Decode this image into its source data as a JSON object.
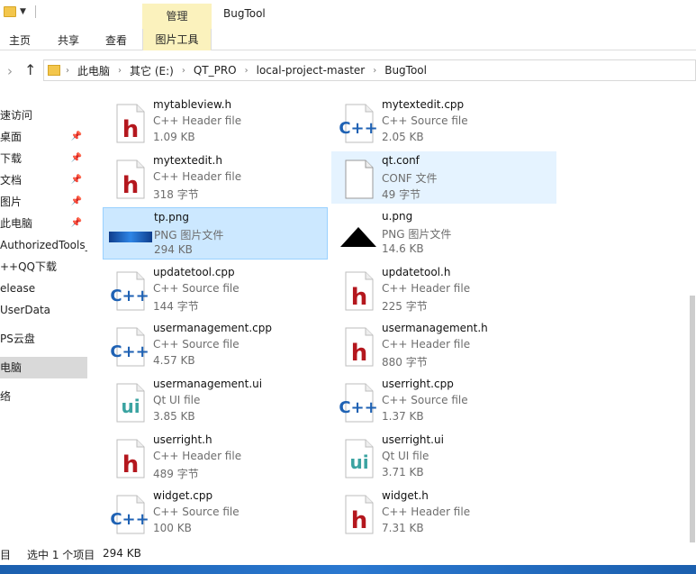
{
  "window": {
    "title": "BugTool",
    "contextual_group": "管理"
  },
  "ribbon": {
    "tabs": [
      "主页",
      "共享",
      "查看"
    ],
    "contextual_tab": "图片工具"
  },
  "address": {
    "crumbs": [
      "此电脑",
      "其它 (E:)",
      "QT_PRO",
      "local-project-master",
      "BugTool"
    ]
  },
  "sidebar": {
    "items": [
      "速访问",
      "桌面",
      "下载",
      "文档",
      "图片",
      "此电脑",
      "AuthorizedTools_I",
      "++QQ下载",
      "elease",
      "UserData",
      "PS云盘",
      "电脑",
      "络"
    ],
    "selected_index": 11
  },
  "files": [
    {
      "name": "mytableview.h",
      "type": "C++ Header file",
      "size": "1.09 KB",
      "icon": "h"
    },
    {
      "name": "mytextedit.cpp",
      "type": "C++ Source file",
      "size": "2.05 KB",
      "icon": "cpp"
    },
    {
      "name": "mytextedit.h",
      "type": "C++ Header file",
      "size": "318 字节",
      "icon": "h"
    },
    {
      "name": "qt.conf",
      "type": "CONF 文件",
      "size": "49 字节",
      "icon": "doc"
    },
    {
      "name": "tp.png",
      "type": "PNG 图片文件",
      "size": "294 KB",
      "icon": "png-blue"
    },
    {
      "name": "u.png",
      "type": "PNG 图片文件",
      "size": "14.6 KB",
      "icon": "png-tri"
    },
    {
      "name": "updatetool.cpp",
      "type": "C++ Source file",
      "size": "144 字节",
      "icon": "cpp"
    },
    {
      "name": "updatetool.h",
      "type": "C++ Header file",
      "size": "225 字节",
      "icon": "h"
    },
    {
      "name": "usermanagement.cpp",
      "type": "C++ Source file",
      "size": "4.57 KB",
      "icon": "cpp"
    },
    {
      "name": "usermanagement.h",
      "type": "C++ Header file",
      "size": "880 字节",
      "icon": "h"
    },
    {
      "name": "usermanagement.ui",
      "type": "Qt UI file",
      "size": "3.85 KB",
      "icon": "ui"
    },
    {
      "name": "userright.cpp",
      "type": "C++ Source file",
      "size": "1.37 KB",
      "icon": "cpp"
    },
    {
      "name": "userright.h",
      "type": "C++ Header file",
      "size": "489 字节",
      "icon": "h"
    },
    {
      "name": "userright.ui",
      "type": "Qt UI file",
      "size": "3.71 KB",
      "icon": "ui"
    },
    {
      "name": "widget.cpp",
      "type": "C++ Source file",
      "size": "100 KB",
      "icon": "cpp"
    },
    {
      "name": "widget.h",
      "type": "C++ Header file",
      "size": "7.31 KB",
      "icon": "h"
    }
  ],
  "status": {
    "count_prefix": "目",
    "selection": "选中 1 个项目",
    "selection_size": "294 KB"
  },
  "colors": {
    "accent": "#cce8ff",
    "h_red": "#b4171e",
    "cpp_blue": "#1f62b4",
    "ui_teal": "#3aa3a1"
  }
}
